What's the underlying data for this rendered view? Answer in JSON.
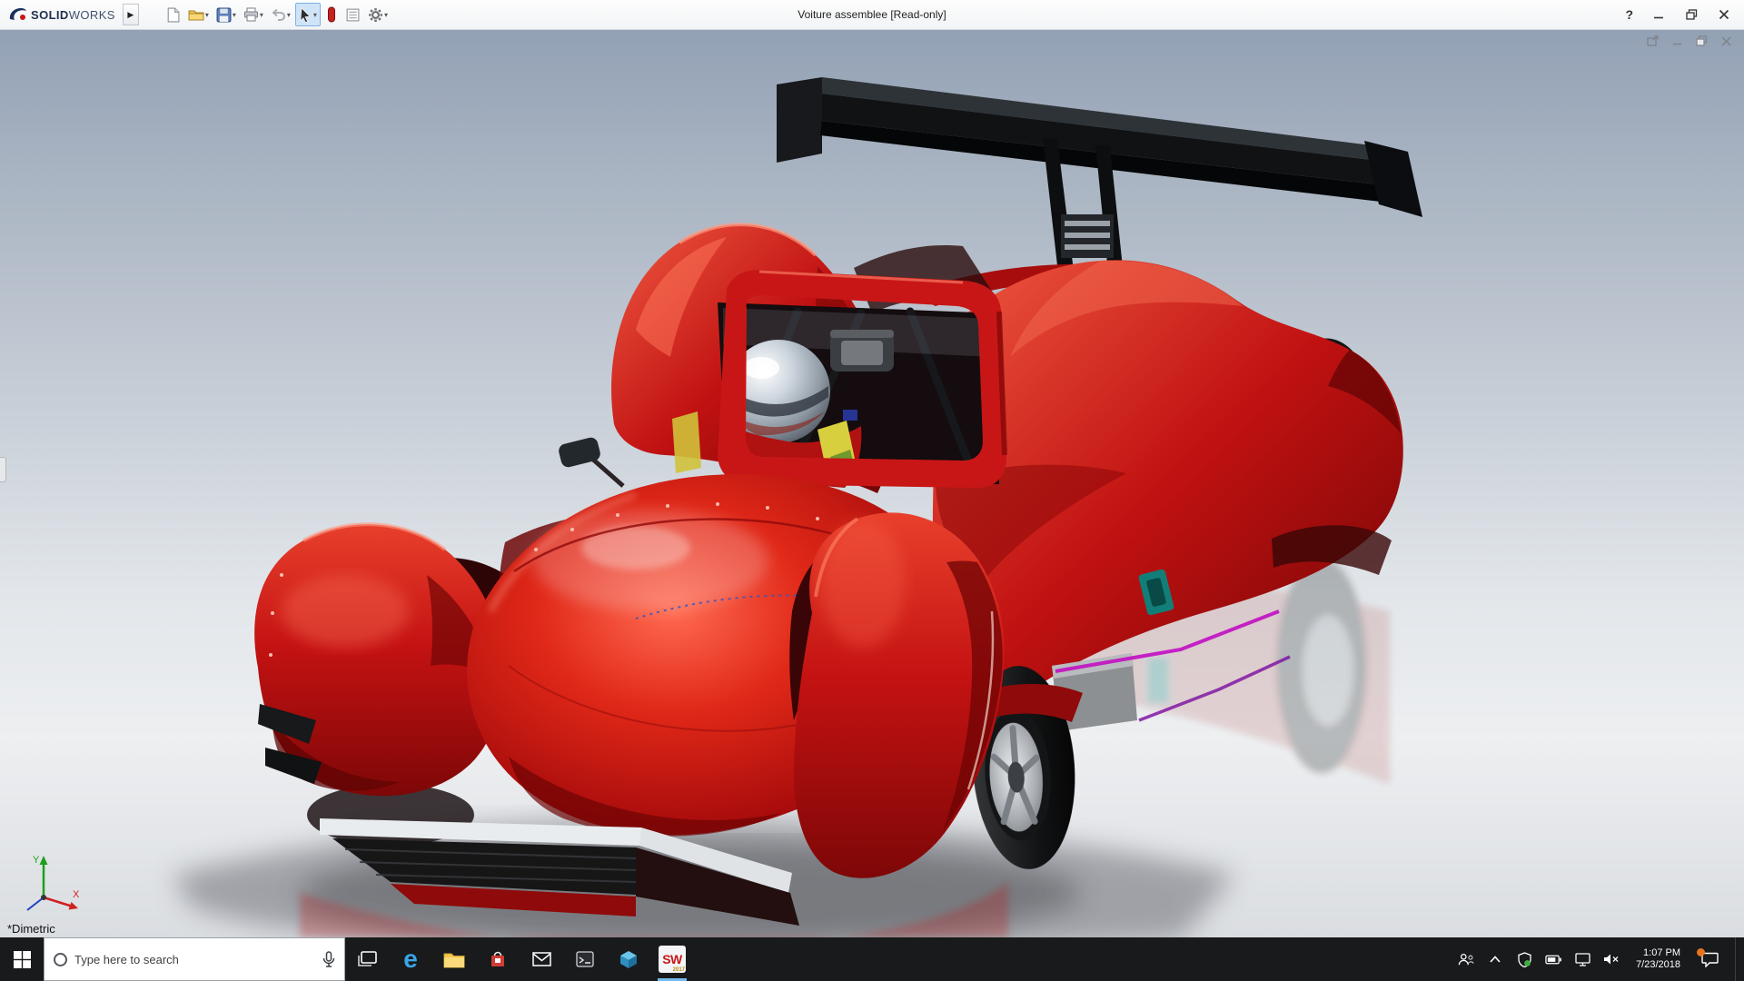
{
  "titlebar": {
    "brand": {
      "solid": "SOLID",
      "works": "WORKS"
    },
    "title": "Voiture assemblee [Read-only]",
    "help": "?",
    "toolbar_icons": [
      "new-document",
      "open",
      "save",
      "print",
      "undo",
      "select-tool",
      "instant3d-toggle",
      "document-sheet",
      "options-gear"
    ],
    "window_controls": [
      "minimize",
      "restore",
      "close"
    ]
  },
  "viewport": {
    "orientation_label": "*Dimetric",
    "triad": {
      "x": "X",
      "y": "Y"
    },
    "window_controls": [
      "float-window",
      "minimize-window",
      "restore-window",
      "close-window"
    ],
    "model": "red LMP race car with black rear wing, chrome-helmet driver, floor reflection"
  },
  "taskbar": {
    "search": {
      "placeholder": "Type here to search"
    },
    "edge_glyph": "e",
    "solidworks": {
      "label": "SW",
      "year": "2017"
    },
    "clock": {
      "time": "1:07 PM",
      "date": "7/23/2018"
    },
    "pinned_icons": [
      "start",
      "search",
      "task-view",
      "edge",
      "file-explorer",
      "store",
      "mail",
      "console-app",
      "3d-app",
      "solidworks-2017"
    ],
    "tray_icons": [
      "people",
      "hidden-icons-chevron",
      "status-shield",
      "battery",
      "ethernet-display",
      "volume",
      "action-center"
    ]
  },
  "colors": {
    "car_red": "#c41212",
    "wing_black": "#101214",
    "select_highlight": "#cfe4f7",
    "taskbar_bg": "#181a1b",
    "badge_orange": "#e8731e"
  }
}
